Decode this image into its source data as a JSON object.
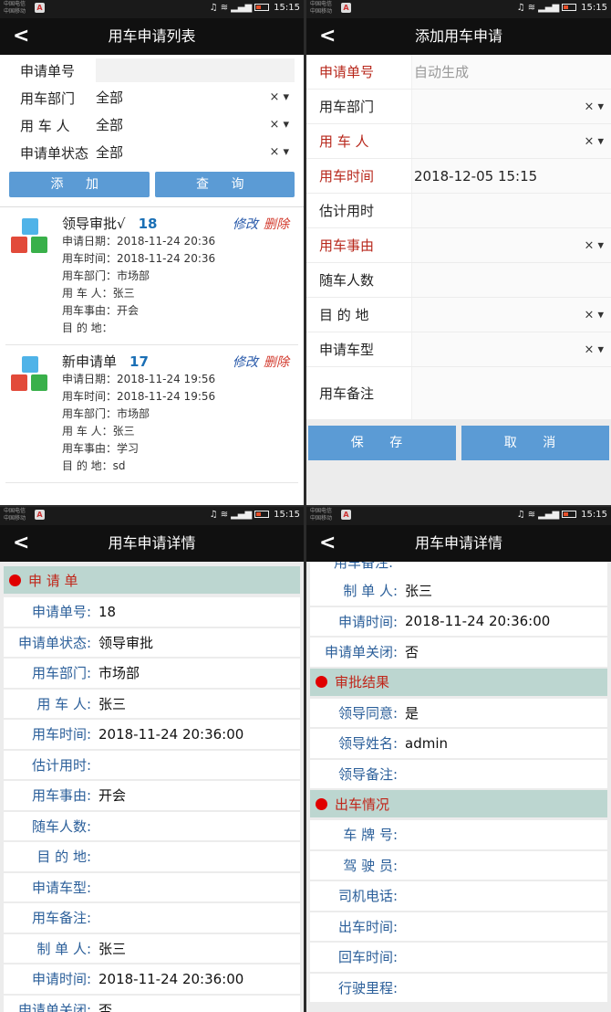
{
  "status_bar": {
    "carrier_line1": "中国电信",
    "carrier_line2": "中国移动",
    "time": "15:15"
  },
  "screen_list": {
    "title": "用车申请列表",
    "filters": [
      {
        "label": "申请单号",
        "value": "",
        "has_select": false
      },
      {
        "label": "用车部门",
        "value": "全部",
        "has_select": true
      },
      {
        "label": "用 车 人",
        "value": "全部",
        "has_select": true
      },
      {
        "label": "申请单状态",
        "value": "全部",
        "has_select": true
      }
    ],
    "add_label": "添 加",
    "query_label": "查 询",
    "edit_label": "修改",
    "delete_label": "删除",
    "items": [
      {
        "status": "领导审批√",
        "id": "18",
        "lines": [
          "申请日期：2018-11-24 20:36",
          "用车时间：2018-11-24 20:36",
          "用车部门：市场部",
          "用 车 人：张三",
          "用车事由：开会",
          "目 的 地："
        ]
      },
      {
        "status": "新申请单",
        "id": "17",
        "lines": [
          "申请日期：2018-11-24 19:56",
          "用车时间：2018-11-24 19:56",
          "用车部门：市场部",
          "用 车 人：张三",
          "用车事由：学习",
          "目 的 地：sd"
        ]
      }
    ]
  },
  "screen_add": {
    "title": "添加用车申请",
    "fields": [
      {
        "label": "申请单号",
        "value": "",
        "placeholder": "自动生成",
        "required": true,
        "has_select": false
      },
      {
        "label": "用车部门",
        "value": "",
        "placeholder": "",
        "required": false,
        "has_select": true
      },
      {
        "label": "用 车 人",
        "value": "",
        "placeholder": "",
        "required": true,
        "has_select": true
      },
      {
        "label": "用车时间",
        "value": "2018-12-05 15:15",
        "placeholder": "",
        "required": true,
        "has_select": false
      },
      {
        "label": "估计用时",
        "value": "",
        "placeholder": "",
        "required": false,
        "has_select": false
      },
      {
        "label": "用车事由",
        "value": "",
        "placeholder": "",
        "required": true,
        "has_select": true
      },
      {
        "label": "随车人数",
        "value": "",
        "placeholder": "",
        "required": false,
        "has_select": false
      },
      {
        "label": "目 的 地",
        "value": "",
        "placeholder": "",
        "required": false,
        "has_select": true
      },
      {
        "label": "申请车型",
        "value": "",
        "placeholder": "",
        "required": false,
        "has_select": true
      },
      {
        "label": "用车备注",
        "value": "",
        "placeholder": "",
        "required": false,
        "has_select": false
      }
    ],
    "save_label": "保 存",
    "cancel_label": "取 消"
  },
  "screen_detail": {
    "title": "用车申请详情",
    "section_title": "申 请 单",
    "rows": [
      {
        "label": "申请单号:",
        "value": "18"
      },
      {
        "label": "申请单状态:",
        "value": "领导审批"
      },
      {
        "label": "用车部门:",
        "value": "市场部"
      },
      {
        "label": "用 车 人:",
        "value": "张三"
      },
      {
        "label": "用车时间:",
        "value": "2018-11-24 20:36:00"
      },
      {
        "label": "估计用时:",
        "value": ""
      },
      {
        "label": "用车事由:",
        "value": "开会"
      },
      {
        "label": "随车人数:",
        "value": ""
      },
      {
        "label": "目 的 地:",
        "value": ""
      },
      {
        "label": "申请车型:",
        "value": ""
      },
      {
        "label": "用车备注:",
        "value": ""
      },
      {
        "label": "制 单 人:",
        "value": "张三"
      },
      {
        "label": "申请时间:",
        "value": "2018-11-24 20:36:00"
      },
      {
        "label": "申请单关闭:",
        "value": "否"
      }
    ]
  },
  "screen_detail_scrolled": {
    "title": "用车申请详情",
    "top_rows": [
      {
        "label": "制 单 人:",
        "value": "张三"
      },
      {
        "label": "申请时间:",
        "value": "2018-11-24 20:36:00"
      },
      {
        "label": "申请单关闭:",
        "value": "否"
      }
    ],
    "approval_title": "审批结果",
    "approval_rows": [
      {
        "label": "领导同意:",
        "value": "是"
      },
      {
        "label": "领导姓名:",
        "value": "admin"
      },
      {
        "label": "领导备注:",
        "value": ""
      }
    ],
    "dispatch_title": "出车情况",
    "dispatch_rows": [
      {
        "label": "车 牌 号:",
        "value": ""
      },
      {
        "label": "驾 驶 员:",
        "value": ""
      },
      {
        "label": "司机电话:",
        "value": ""
      },
      {
        "label": "出车时间:",
        "value": ""
      },
      {
        "label": "回车时间:",
        "value": ""
      },
      {
        "label": "行驶里程:",
        "value": ""
      }
    ]
  },
  "colors": {
    "accent": "#5b9bd5",
    "required": "#b8281c",
    "section_bg": "#bcd6d0",
    "section_dot": "#e00000",
    "detail_label": "#2b5f9a",
    "edit": "#2456a8",
    "delete": "#d2392c"
  },
  "icons": {
    "back": "chevron-left-icon",
    "clear": "clear-x-icon",
    "dropdown": "caret-down-icon",
    "item": "cubes-icon"
  }
}
